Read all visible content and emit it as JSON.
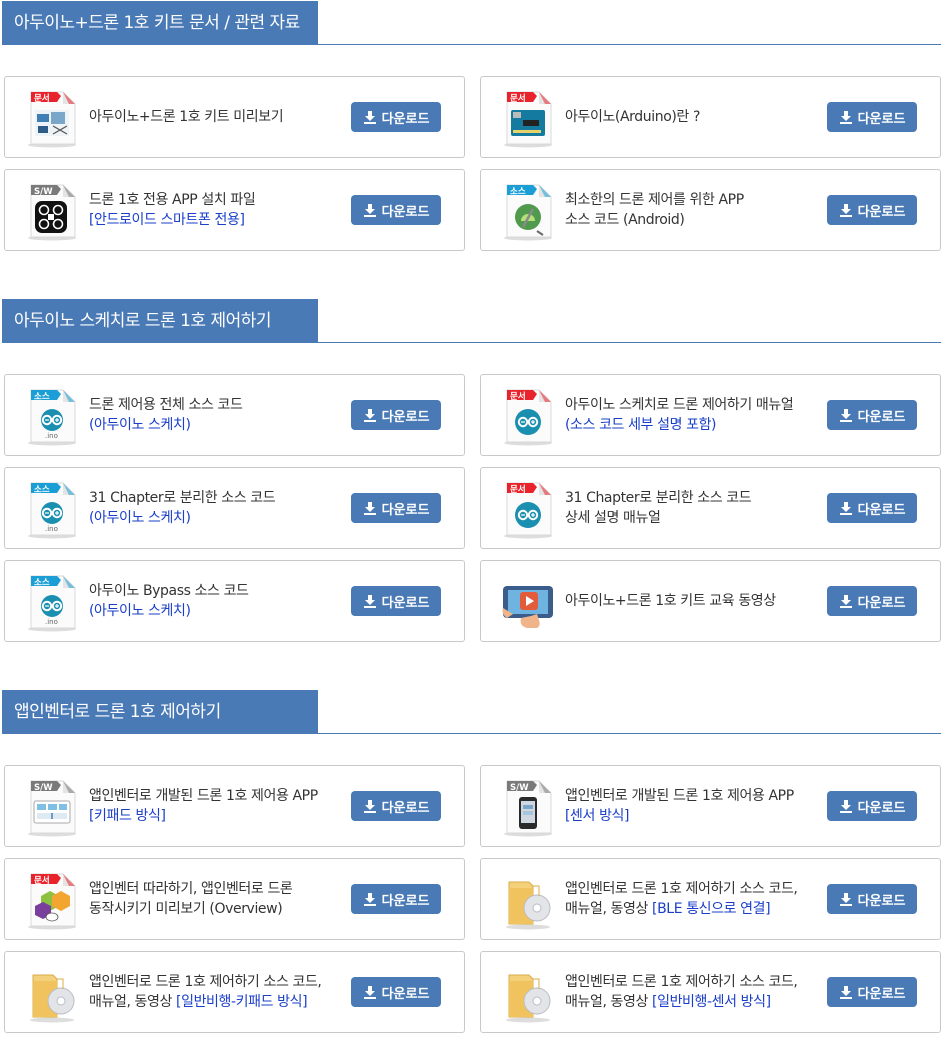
{
  "download_label": "다운로드",
  "sections": [
    {
      "title": "아두이노+드론 1호 키트 문서 / 관련 자료",
      "items": [
        {
          "icon": "doc-kit-preview-icon",
          "badge": "문서",
          "l1": "아두이노+드론 1호 키트 미리보기",
          "l2": "",
          "l2_prefix": ""
        },
        {
          "icon": "doc-arduino-board-icon",
          "badge": "문서",
          "l1": "아두이노(Arduino)란 ?",
          "l2": "",
          "l2_prefix": ""
        },
        {
          "icon": "sw-drone-app-icon",
          "badge": "S/W",
          "l1": "드론 1호 전용 APP 설치 파일",
          "l2": "[안드로이드 스마트폰 전용]",
          "l2_prefix": ""
        },
        {
          "icon": "source-android-studio-icon",
          "badge": "소스",
          "l1": "최소한의 드론 제어를 위한 APP",
          "l2": "",
          "l2_prefix": "소스 코드 (Android)"
        }
      ]
    },
    {
      "title": "아두이노 스케치로 드론 1호 제어하기",
      "items": [
        {
          "icon": "source-ino-file-icon",
          "badge": "소스",
          "l1": "드론 제어용 전체 소스 코드",
          "l2": "(아두이노 스케치)",
          "l2_prefix": ""
        },
        {
          "icon": "doc-arduino-logo-icon",
          "badge": "문서",
          "l1": "아두이노 스케치로 드론 제어하기 매뉴얼",
          "l2": "(소스 코드 세부 설명 포함)",
          "l2_prefix": ""
        },
        {
          "icon": "source-ino-file-icon",
          "badge": "소스",
          "l1": "31 Chapter로 분리한 소스 코드",
          "l2": "(아두이노 스케치)",
          "l2_prefix": ""
        },
        {
          "icon": "doc-arduino-logo-icon",
          "badge": "문서",
          "l1": "31 Chapter로 분리한 소스 코드",
          "l2": "",
          "l2_prefix": "상세 설명 매뉴얼"
        },
        {
          "icon": "source-ino-file-icon",
          "badge": "소스",
          "l1": "아두이노 Bypass 소스 코드",
          "l2": "(아두이노 스케치)",
          "l2_prefix": ""
        },
        {
          "icon": "video-tablet-play-icon",
          "badge": "",
          "l1": "아두이노+드론 1호 키트 교육 동영상",
          "l2": "",
          "l2_prefix": ""
        }
      ]
    },
    {
      "title": "앱인벤터로 드론 1호 제어하기",
      "items": [
        {
          "icon": "sw-keypad-app-icon",
          "badge": "S/W",
          "l1": "앱인벤터로 개발된 드론 1호 제어용 APP",
          "l2": "[키패드 방식]",
          "l2_prefix": ""
        },
        {
          "icon": "sw-phone-sensor-icon",
          "badge": "S/W",
          "l1": "앱인벤터로 개발된 드론 1호 제어용 APP",
          "l2": "[센서 방식]",
          "l2_prefix": ""
        },
        {
          "icon": "doc-app-inventor-icon",
          "badge": "문서",
          "l1": "앱인벤터 따라하기, 앱인벤터로 드론",
          "l2": "",
          "l2_prefix": "동작시키기 미리보기 (Overview)"
        },
        {
          "icon": "folder-disc-icon",
          "badge": "",
          "l1": "앱인벤터로 드론 1호 제어하기 소스 코드,",
          "l2": "[BLE 통신으로 연결]",
          "l2_prefix": "매뉴얼, 동영상 "
        },
        {
          "icon": "folder-disc-icon",
          "badge": "",
          "l1": "앱인벤터로 드론 1호 제어하기 소스 코드,",
          "l2": "[일반비행-키패드 방식]",
          "l2_prefix": "매뉴얼, 동영상 "
        },
        {
          "icon": "folder-disc-icon",
          "badge": "",
          "l1": "앱인벤터로 드론 1호 제어하기 소스 코드,",
          "l2": "[일반비행-센서 방식]",
          "l2_prefix": "매뉴얼, 동영상 "
        }
      ]
    }
  ],
  "colors": {
    "accent": "#4a7ab6",
    "link_blue": "#1a3ec9",
    "badge_red": "#e8232b",
    "badge_gray": "#7a7a7a",
    "badge_teal": "#1b9ed6"
  }
}
